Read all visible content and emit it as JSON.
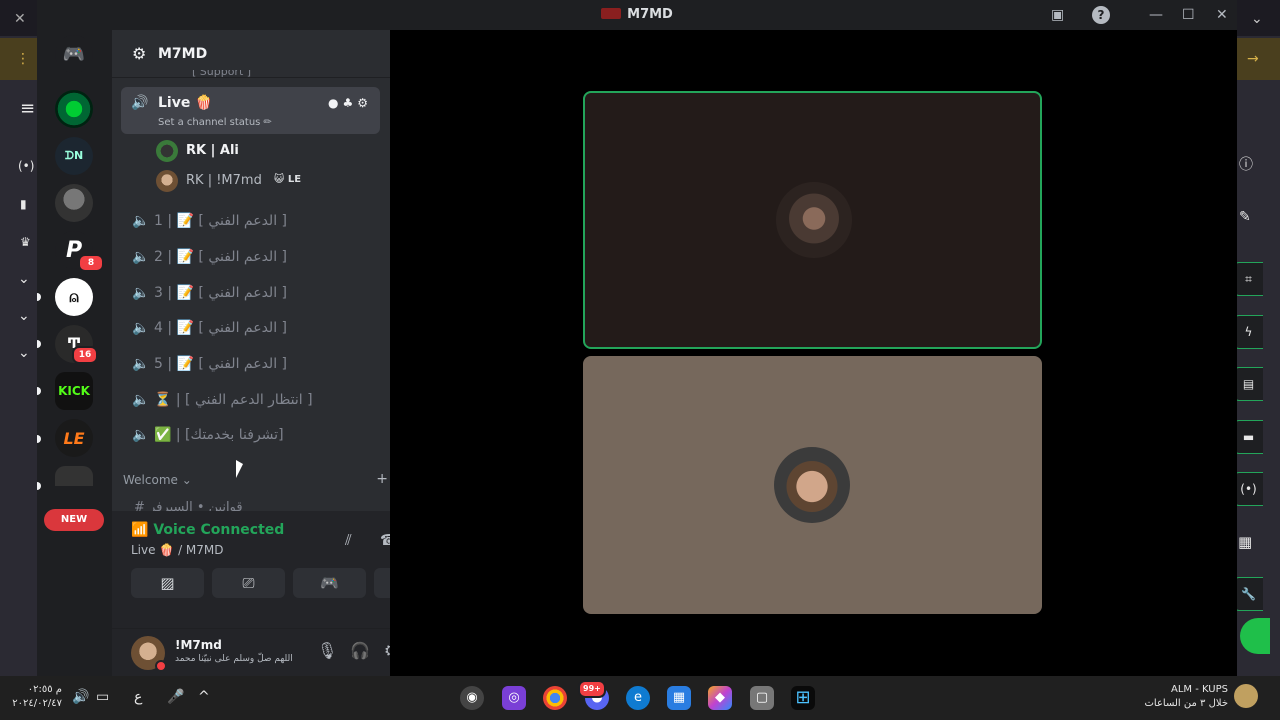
{
  "window": {
    "title": "M7MD"
  },
  "server": {
    "name": "M7MD"
  },
  "top_cut_channel": "[ Support ]",
  "live_channel": {
    "name": "Live 🍿",
    "status": "Set a channel status ✏"
  },
  "members": [
    {
      "name": "RK  |  Ali"
    },
    {
      "name": "RK | !M7md",
      "tag": "😺 LE"
    }
  ],
  "voice_channels": [
    {
      "label": "1 | 📝 [ الدعم الفني ]"
    },
    {
      "label": "2 | 📝 [ الدعم الفني ]"
    },
    {
      "label": "3 | 📝 [ الدعم الفني ]"
    },
    {
      "label": "4 | 📝 [ الدعم الفني ]"
    },
    {
      "label": "5 | 📝 [ الدعم الفني ]"
    },
    {
      "label": "⏳ | [ انتظار الدعم الفني ]"
    },
    {
      "label": "✅ | [تشرفنا بخدمتك]"
    }
  ],
  "category": {
    "name": "Welcome ⌄",
    "text_channel": "# قوانين • السيرفر"
  },
  "rail": {
    "new_label": "NEW",
    "kick_label": "KICK",
    "badge_1": "8",
    "badge_2": "16"
  },
  "voice_panel": {
    "title": "Voice Connected",
    "subtitle": "Live 🍿 / M7MD"
  },
  "user": {
    "name": "!M7md",
    "status": "اللهم صلّ وسلم على نبيّنا محمد"
  },
  "taskbar": {
    "clock_time": "م ٠٢:٥٥",
    "clock_date": "٢٠٢٤/٠٢/٤٧",
    "ime": "ع",
    "weather_title": "ALM - KUPS",
    "weather_sub": "خلال ٣ من الساعات",
    "discord_badge": "99+"
  },
  "colors": {
    "accent_green": "#23a55a",
    "danger_red": "#f23f43",
    "sidebar_bg": "#2b2d31",
    "rail_bg": "#1e1f22"
  }
}
